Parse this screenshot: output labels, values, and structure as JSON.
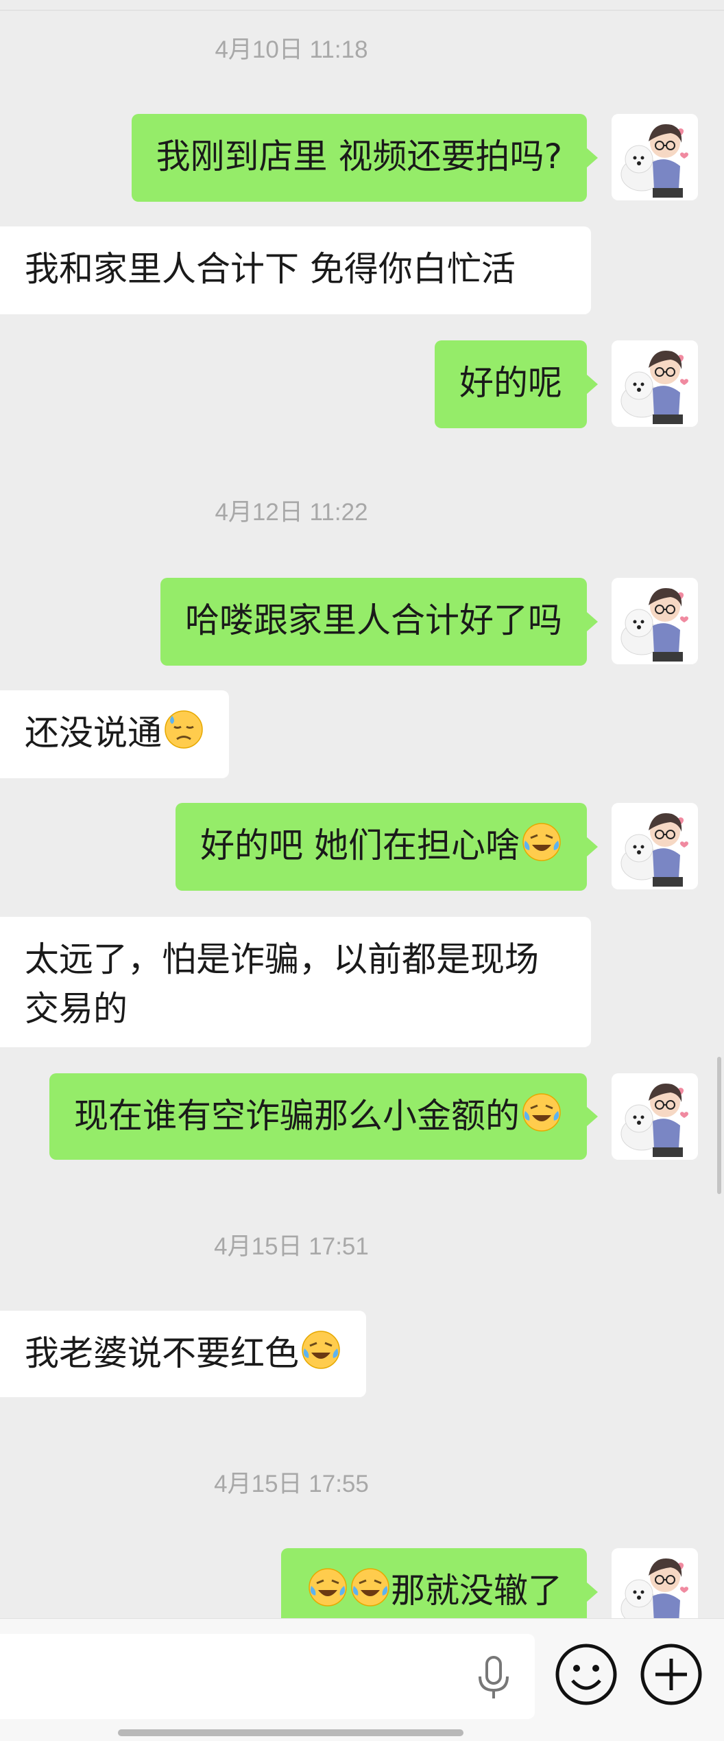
{
  "chat": {
    "timestamps": [
      "4月10日 11:18",
      "4月12日 11:22",
      "4月15日 17:51",
      "4月15日 17:55"
    ],
    "messages": [
      {
        "text": "我刚到店里 视频还要拍吗?"
      },
      {
        "text": "我和家里人合计下 免得你白忙活"
      },
      {
        "text": "好的呢"
      },
      {
        "text": "哈喽跟家里人合计好了吗"
      },
      {
        "text": "还没说通"
      },
      {
        "text": "好的吧 她们在担心啥"
      },
      {
        "text": "太远了，怕是诈骗，以前都是现场"
      },
      {
        "text": "交易的"
      },
      {
        "text": "现在谁有空诈骗那么小金额的"
      },
      {
        "text": "我老婆说不要红色"
      },
      {
        "text": "那就没辙了"
      }
    ],
    "emoji": {
      "sad_sweat": "sad-sweat-emoji",
      "laugh_cry": "laughing-crying-emoji"
    }
  },
  "colors": {
    "outgoing_bubble": "#95ec69",
    "incoming_bubble": "#ffffff",
    "background": "#ededed",
    "timestamp": "#a8a8a8"
  },
  "input_bar": {
    "icons": [
      "microphone-icon",
      "emoji-icon",
      "plus-icon"
    ]
  }
}
